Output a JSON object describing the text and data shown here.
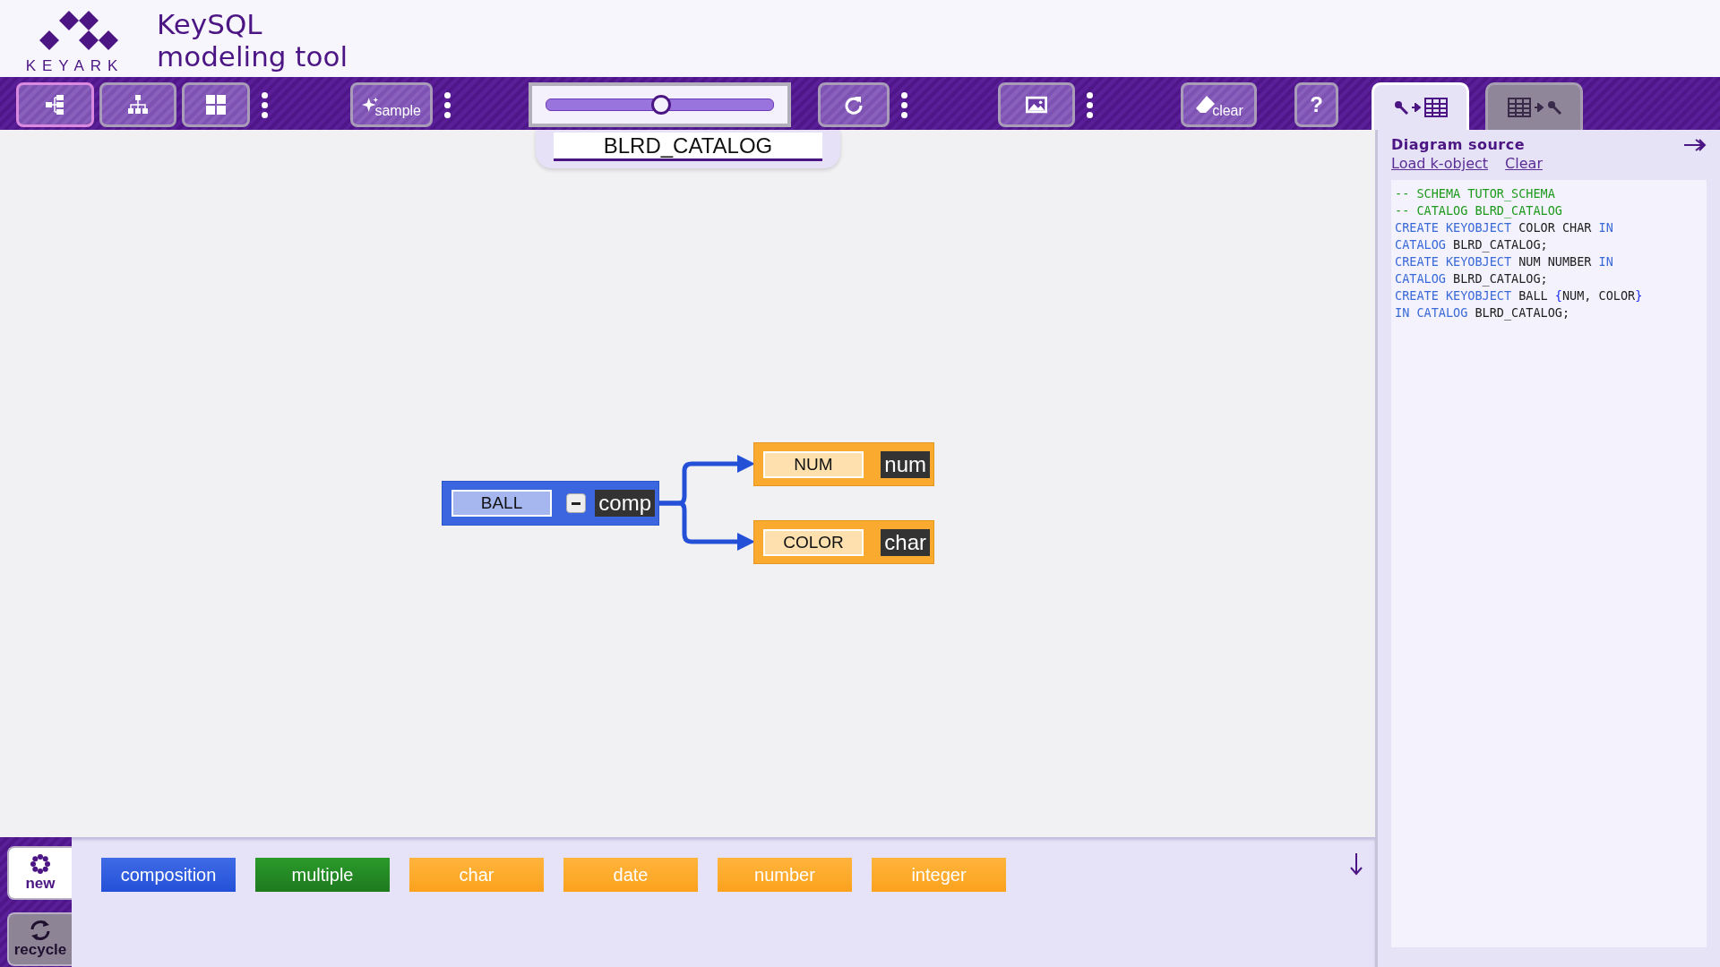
{
  "header": {
    "logo_text": "KEYARK",
    "title_lines": [
      "KeySQL",
      "modeling tool"
    ]
  },
  "toolbar": {
    "groups": [
      {
        "items": [
          {
            "kind": "tree-horizontal",
            "selected": true
          },
          {
            "kind": "tree-vertical",
            "selected": false
          },
          {
            "kind": "grid",
            "selected": false
          },
          {
            "kind": "more"
          }
        ]
      },
      {
        "items": [
          {
            "kind": "sample",
            "label": "sample"
          },
          {
            "kind": "more"
          }
        ]
      },
      {
        "items": [
          {
            "kind": "zoom",
            "level": 0.5
          }
        ]
      },
      {
        "items": [
          {
            "kind": "refresh"
          },
          {
            "kind": "more"
          }
        ]
      },
      {
        "items": [
          {
            "kind": "image"
          },
          {
            "kind": "more"
          }
        ]
      },
      {
        "items": [
          {
            "kind": "clear",
            "label": "clear"
          }
        ]
      },
      {
        "items": [
          {
            "kind": "help",
            "label": "?"
          }
        ]
      }
    ],
    "tabs": [
      {
        "kind": "key-to-table",
        "selected": true
      },
      {
        "kind": "table-to-key",
        "selected": false
      }
    ]
  },
  "catalog_field": {
    "value": "BLRD_CATALOG"
  },
  "diagram": {
    "root": {
      "label": "BALL",
      "type": "comp",
      "expanded": true,
      "children": [
        {
          "label": "NUM",
          "type": "num"
        },
        {
          "label": "COLOR",
          "type": "char"
        }
      ]
    }
  },
  "palette": {
    "side_buttons": [
      {
        "kind": "new",
        "label": "new",
        "selected": true
      },
      {
        "kind": "recycle",
        "label": "recycle",
        "selected": false
      }
    ],
    "items": [
      {
        "label": "composition",
        "kind": "composition"
      },
      {
        "label": "multiple",
        "kind": "multiple"
      },
      {
        "label": "char",
        "kind": "scalar"
      },
      {
        "label": "date",
        "kind": "scalar"
      },
      {
        "label": "number",
        "kind": "scalar"
      },
      {
        "label": "integer",
        "kind": "scalar"
      }
    ]
  },
  "source_panel": {
    "title": "Diagram source",
    "links": [
      "Load k-object",
      "Clear"
    ],
    "code_lines": [
      [
        {
          "kind": "comment",
          "text": "-- SCHEMA TUTOR_SCHEMA"
        }
      ],
      [
        {
          "kind": "comment",
          "text": "-- CATALOG BLRD_CATALOG"
        }
      ],
      [
        {
          "kind": "keyword",
          "text": "CREATE KEYOBJECT "
        },
        {
          "kind": "ident",
          "text": "COLOR CHAR "
        },
        {
          "kind": "keyword",
          "text": "IN"
        }
      ],
      [
        {
          "kind": "keyword",
          "text": "CATALOG "
        },
        {
          "kind": "ident",
          "text": "BLRD_CATALOG;"
        }
      ],
      [
        {
          "kind": "keyword",
          "text": "CREATE KEYOBJECT "
        },
        {
          "kind": "ident",
          "text": "NUM NUMBER "
        },
        {
          "kind": "keyword",
          "text": "IN"
        }
      ],
      [
        {
          "kind": "keyword",
          "text": "CATALOG "
        },
        {
          "kind": "ident",
          "text": "BLRD_CATALOG;"
        }
      ],
      [
        {
          "kind": "keyword",
          "text": "CREATE KEYOBJECT "
        },
        {
          "kind": "ident",
          "text": "BALL "
        },
        {
          "kind": "brace",
          "text": "{"
        },
        {
          "kind": "ident",
          "text": "NUM, COLOR"
        },
        {
          "kind": "brace",
          "text": "}"
        }
      ],
      [
        {
          "kind": "keyword",
          "text": "IN CATALOG "
        },
        {
          "kind": "ident",
          "text": "BLRD_CATALOG;"
        }
      ]
    ]
  }
}
